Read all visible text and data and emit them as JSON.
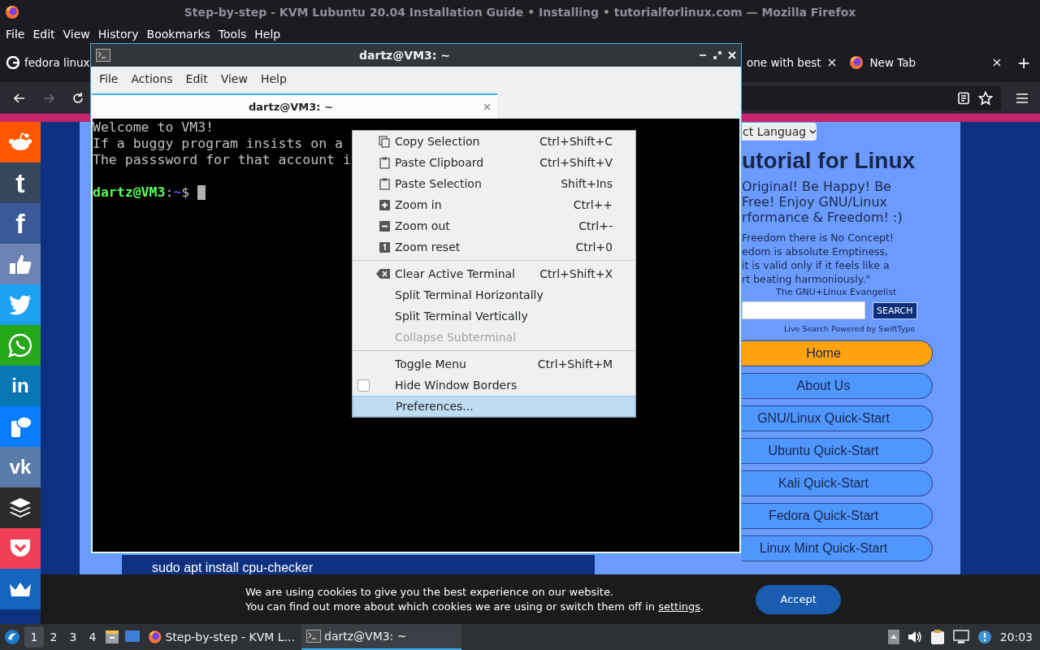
{
  "browser": {
    "title": "Step-by-step - KVM Lubuntu 20.04 Installation Guide • Installing • tutorialforlinux.com — Mozilla Firefox",
    "menu": [
      "File",
      "Edit",
      "View",
      "History",
      "Bookmarks",
      "Tools",
      "Help"
    ],
    "tabs": [
      {
        "label": "fedora linux",
        "kind": "favicon",
        "selected": false,
        "closable": false
      },
      {
        "label": "one with best",
        "kind": "plain",
        "selected": false,
        "closable": true
      },
      {
        "label": "New Tab",
        "kind": "browser",
        "selected": false,
        "closable": true
      }
    ],
    "new_tab": "+",
    "page": {
      "share_buttons": [
        {
          "kind": "alien",
          "color": "#ff5700"
        },
        {
          "kind": "glyph",
          "glyph": "t",
          "color": "#36465d"
        },
        {
          "kind": "glyph",
          "glyph": "f",
          "color": "#3b5998"
        },
        {
          "kind": "thumb",
          "color": "#6c83b3"
        },
        {
          "kind": "bird",
          "color": "#1da1f2"
        },
        {
          "kind": "whatsapp",
          "color": "#25a81a"
        },
        {
          "kind": "glyph",
          "glyph": "in",
          "color": "#0a77b5"
        },
        {
          "kind": "sms",
          "color": "#0a7cff"
        },
        {
          "kind": "glyph",
          "glyph": "vk",
          "color": "#5a7ca8"
        },
        {
          "kind": "layers",
          "color": "#2b2b2b"
        },
        {
          "kind": "pocket",
          "color": "#ef4056"
        },
        {
          "kind": "crown",
          "color": "#1565c0"
        }
      ],
      "code_line": "sudo apt install cpu-checker",
      "language_select": "ct Languag",
      "site_title": "utorial for Linux",
      "tagline": [
        "Original! Be Happy! Be",
        "Free! Enjoy GNU/Linux",
        "rformance & Freedom! :)"
      ],
      "quote": [
        "Freedom there is No Concept!",
        "edom is absolute Emptiness,",
        "it is valid only if it feels like a",
        "rt beating harmoniously.\""
      ],
      "quote_author": "The GNU+Linux Evangelist",
      "search_button": "SEARCH",
      "search_note": "Live Search Powered by SwiftType",
      "nav": [
        {
          "label": "Home",
          "selected": true
        },
        {
          "label": "About Us",
          "selected": false
        },
        {
          "label": "GNU/Linux Quick-Start",
          "selected": false
        },
        {
          "label": "Ubuntu Quick-Start",
          "selected": false
        },
        {
          "label": "Kali Quick-Start",
          "selected": false
        },
        {
          "label": "Fedora Quick-Start",
          "selected": false
        },
        {
          "label": "Linux Mint Quick-Start",
          "selected": false
        }
      ]
    },
    "cookie": {
      "line1": "We are using cookies to give you the best experience on our website.",
      "line2": "You can find out more about which cookies we are using or switch them off in",
      "link": "settings",
      "end": ".",
      "button": "Accept"
    }
  },
  "terminal": {
    "title": "dartz@VM3: ~",
    "menu": [
      "File",
      "Actions",
      "Edit",
      "View",
      "Help"
    ],
    "tab": {
      "label": "dartz@VM3: ~",
      "selected": true
    },
    "lines": [
      "Welcome to VM3!",
      "If a buggy program insists on a",
      "The passsword for that account i"
    ],
    "prompt": {
      "user_host": "dartz@VM3",
      "separator": ":",
      "path": "~",
      "symbol": "$"
    },
    "context_menu": [
      [
        {
          "label": "Copy Selection",
          "shortcut": "Ctrl+Shift+C",
          "kind": "copy",
          "disabled": false,
          "selected": false
        },
        {
          "label": "Paste Clipboard",
          "shortcut": "Ctrl+Shift+V",
          "kind": "paste",
          "disabled": false,
          "selected": false
        },
        {
          "label": "Paste Selection",
          "shortcut": "Shift+Ins",
          "kind": "paste",
          "disabled": false,
          "selected": false
        },
        {
          "label": "Zoom in",
          "shortcut": "Ctrl++",
          "kind": "zoom-in",
          "disabled": false,
          "selected": false
        },
        {
          "label": "Zoom out",
          "shortcut": "Ctrl+-",
          "kind": "zoom-out",
          "disabled": false,
          "selected": false
        },
        {
          "label": "Zoom reset",
          "shortcut": "Ctrl+0",
          "kind": "zoom-reset",
          "disabled": false,
          "selected": false
        }
      ],
      [
        {
          "label": "Clear Active Terminal",
          "shortcut": "Ctrl+Shift+X",
          "kind": "clear",
          "disabled": false,
          "selected": false
        },
        {
          "label": "Split Terminal Horizontally",
          "kind": "plain",
          "disabled": false,
          "selected": false
        },
        {
          "label": "Split Terminal Vertically",
          "kind": "plain",
          "disabled": false,
          "selected": false
        },
        {
          "label": "Collapse Subterminal",
          "kind": "plain",
          "disabled": true,
          "selected": false
        }
      ],
      [
        {
          "label": "Toggle Menu",
          "shortcut": "Ctrl+Shift+M",
          "kind": "plain",
          "disabled": false,
          "selected": false
        },
        {
          "label": "Hide Window Borders",
          "kind": "checkbox",
          "checked": false,
          "disabled": false,
          "selected": false
        },
        {
          "label": "Preferences...",
          "kind": "plain",
          "disabled": false,
          "selected": true
        }
      ]
    ]
  },
  "taskbar": {
    "workspaces": [
      {
        "label": "1",
        "selected": true
      },
      {
        "label": "2",
        "selected": false
      },
      {
        "label": "3",
        "selected": false
      },
      {
        "label": "4",
        "selected": false
      }
    ],
    "tasks": [
      {
        "label": "Step-by-step - KVM L...",
        "kind": "browser",
        "selected": false
      },
      {
        "label": "dartz@VM3: ~",
        "kind": "terminal",
        "selected": true
      }
    ],
    "clock": "20:03"
  }
}
